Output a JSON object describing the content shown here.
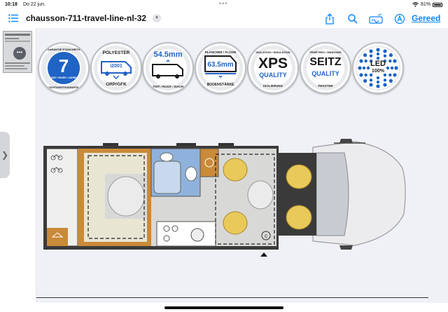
{
  "status": {
    "time": "10:18",
    "date": "Do 22 jun.",
    "battery_pct": "81%",
    "battery_level": 0.81
  },
  "toolbar": {
    "title": "chausson-711-travel-line-nl-32",
    "done_label": "Gereed",
    "icons": [
      "list-icon",
      "share-icon",
      "search-icon",
      "markup-icon",
      "autofill-icon"
    ]
  },
  "badges": [
    {
      "name": "warranty",
      "top": "GARANTIE ETANCHEITE",
      "big": "7",
      "sub": "ANS / YEARS / JAHRE",
      "bottom": "DICHTIGKEITSGARANTIE"
    },
    {
      "name": "polyester",
      "top": "POLYESTER",
      "big": "",
      "sub": "i2001",
      "bottom": "GRP/GFK"
    },
    {
      "name": "roof",
      "top": "",
      "big": "54.5mm",
      "sub": "",
      "bottom": "TOIT / ROOF / DACH"
    },
    {
      "name": "floor",
      "top": "PLANCHER / FLOOR",
      "big": "63.5mm",
      "sub": "",
      "bottom": "BODENSTÄRKE"
    },
    {
      "name": "insulation",
      "top": "ISOLATION / INSULATION",
      "big": "XPS",
      "sub": "QUALITY",
      "bottom": "ISOLIERUNG"
    },
    {
      "name": "windows",
      "top": "FENÊTRES / WINDOWS",
      "big": "SEITZ",
      "sub": "QUALITY",
      "bottom": "FENSTER"
    },
    {
      "name": "led",
      "top": "",
      "big": "LED",
      "sub": "100%",
      "bottom": ""
    }
  ],
  "colors": {
    "accent": "#0a84ff",
    "badge_blue": "#1f63c4",
    "wood": "#c98a3a",
    "bed": "#e9e5d3",
    "seat": "#e8c95a",
    "floor": "#d8d8d6",
    "dark": "#333333",
    "bathroom": "#8fb2dc"
  }
}
